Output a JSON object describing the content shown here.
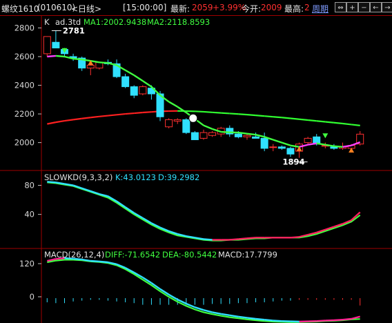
{
  "header": {
    "symbol": "螺纹1610",
    "code": "(010610)",
    "period": "<日线>",
    "time": "[15:00:00]",
    "latest_label": "最新:",
    "latest_value": "2059",
    "change_pct": "+3.99%",
    "open_label": "今开:",
    "open_value": "2009",
    "high_label": "最高:",
    "high_value": "2",
    "cycle_link": "周期",
    "buttons": [
      {
        "icon": "expand-icon",
        "glyph": "⇔"
      },
      {
        "icon": "zoom-in-icon",
        "glyph": "+"
      },
      {
        "icon": "zoom-out-icon",
        "glyph": "−"
      },
      {
        "icon": "arrow-left-icon",
        "glyph": "←"
      },
      {
        "icon": "arrow-right-icon",
        "glyph": "→"
      }
    ]
  },
  "colors": {
    "up": "#ff3030",
    "down": "#30e0ff",
    "ma1": "#40ff40",
    "ma2_down": "#30ff30",
    "ma2_up": "#ff2020",
    "k_line": "#30e0ff",
    "d_line": "#40ff40",
    "diff_line": "#30e0ff",
    "dea_line": "#40ff40",
    "grid": "#a00000"
  },
  "chart_data": [
    {
      "type": "candlestick",
      "panel": "price",
      "label": "K",
      "contract": "ad.3td",
      "indicator_text": [
        "MA1:2002.9438",
        "MA2:2118.8593"
      ],
      "ylim": [
        1820,
        2860
      ],
      "yticks": [
        2000,
        2200,
        2400,
        2600,
        2800
      ],
      "annotations": [
        {
          "text": "2781",
          "bar": 1,
          "value": 2781
        },
        {
          "text": "1894",
          "bar": 29,
          "value": 1894
        }
      ],
      "ohlc": [
        [
          2620,
          2740,
          2600,
          2740
        ],
        [
          2700,
          2781,
          2660,
          2660
        ],
        [
          2650,
          2660,
          2600,
          2620
        ],
        [
          2600,
          2620,
          2570,
          2590
        ],
        [
          2590,
          2600,
          2500,
          2520
        ],
        [
          2520,
          2550,
          2470,
          2540
        ],
        [
          2520,
          2560,
          2510,
          2560
        ],
        [
          2560,
          2580,
          2540,
          2550
        ],
        [
          2550,
          2580,
          2450,
          2460
        ],
        [
          2460,
          2480,
          2380,
          2390
        ],
        [
          2390,
          2400,
          2310,
          2330
        ],
        [
          2340,
          2400,
          2330,
          2390
        ],
        [
          2380,
          2400,
          2300,
          2340
        ],
        [
          2340,
          2360,
          2150,
          2180
        ],
        [
          2110,
          2170,
          2100,
          2160
        ],
        [
          2150,
          2170,
          2130,
          2160
        ],
        [
          2160,
          2170,
          2060,
          2070
        ],
        [
          2070,
          2080,
          2020,
          2020
        ],
        [
          2030,
          2090,
          2020,
          2070
        ],
        [
          2050,
          2080,
          2040,
          2070
        ],
        [
          2060,
          2110,
          2040,
          2100
        ],
        [
          2100,
          2120,
          2040,
          2060
        ],
        [
          2060,
          2080,
          2030,
          2040
        ],
        [
          2040,
          2060,
          2020,
          2050
        ],
        [
          2040,
          2070,
          2030,
          2030
        ],
        [
          2030,
          2070,
          1940,
          1960
        ],
        [
          1970,
          1990,
          1940,
          1970
        ],
        [
          1970,
          1980,
          1950,
          1960
        ],
        [
          1960,
          1970,
          1900,
          1920
        ],
        [
          1940,
          2000,
          1894,
          1990
        ],
        [
          2000,
          2040,
          1990,
          2030
        ],
        [
          2040,
          2060,
          1980,
          1990
        ],
        [
          1980,
          2000,
          1960,
          1980
        ],
        [
          1970,
          1990,
          1950,
          1960
        ],
        [
          1960,
          2000,
          1950,
          1970
        ],
        [
          1960,
          1990,
          1950,
          1980
        ],
        [
          1990,
          2080,
          1980,
          2059
        ]
      ],
      "ma1": [
        2600,
        2605,
        2600,
        2585,
        2580,
        2570,
        2560,
        2555,
        2540,
        2505,
        2470,
        2430,
        2390,
        2330,
        2285,
        2250,
        2210,
        2165,
        2120,
        2095,
        2075,
        2072,
        2070,
        2062,
        2055,
        2040,
        2020,
        2000,
        1980,
        1970,
        1985,
        1995,
        1985,
        1975,
        1970,
        1980,
        2003
      ],
      "ma2": [
        2130,
        2142,
        2152,
        2160,
        2168,
        2175,
        2182,
        2188,
        2194,
        2200,
        2205,
        2210,
        2214,
        2218,
        2220,
        2221,
        2220,
        2218,
        2215,
        2211,
        2207,
        2203,
        2199,
        2195,
        2190,
        2185,
        2180,
        2175,
        2169,
        2163,
        2157,
        2151,
        2145,
        2139,
        2133,
        2126,
        2119
      ]
    },
    {
      "type": "line",
      "panel": "slowkd",
      "label": "SLOWKD(9,3,3,2)",
      "indicator_text": [
        "K:43.0123",
        "D:39.2982"
      ],
      "ylim": [
        -5,
        90
      ],
      "yticks": [
        40,
        80
      ],
      "series": [
        {
          "name": "K",
          "values": [
            85,
            84,
            82,
            80,
            76,
            72,
            68,
            65,
            58,
            50,
            42,
            35,
            28,
            22,
            17,
            13,
            10,
            8,
            6,
            5,
            5,
            5,
            6,
            7,
            8,
            8,
            8,
            8,
            8,
            9,
            12,
            15,
            19,
            23,
            27,
            32,
            43
          ]
        },
        {
          "name": "D",
          "values": [
            84,
            83,
            81,
            79,
            75,
            71,
            67,
            63,
            56,
            48,
            40,
            33,
            26,
            20,
            15,
            11,
            9,
            7,
            5,
            4,
            4,
            5,
            5,
            6,
            7,
            7,
            8,
            8,
            8,
            8,
            10,
            13,
            17,
            21,
            25,
            30,
            39
          ]
        }
      ]
    },
    {
      "type": "line",
      "panel": "macd",
      "label": "MACD(26,12,4)",
      "indicator_text": [
        "DIFF:-71.6542",
        "DEA:-80.5442",
        "MACD:17.7799"
      ],
      "ylim": [
        -95,
        150
      ],
      "yticks": [
        0,
        120
      ],
      "series": [
        {
          "name": "DIFF",
          "values": [
            130,
            137,
            140,
            138,
            135,
            130,
            128,
            125,
            118,
            105,
            88,
            70,
            50,
            28,
            8,
            -10,
            -25,
            -38,
            -48,
            -56,
            -62,
            -67,
            -72,
            -76,
            -80,
            -83,
            -86,
            -88,
            -89,
            -90,
            -89,
            -88,
            -86,
            -85,
            -83,
            -80,
            -71.65
          ]
        },
        {
          "name": "DEA",
          "values": [
            125,
            131,
            134,
            134,
            132,
            128,
            126,
            122,
            114,
            100,
            82,
            62,
            42,
            20,
            0,
            -18,
            -33,
            -46,
            -56,
            -63,
            -69,
            -74,
            -78,
            -82,
            -85,
            -88,
            -90,
            -91,
            -92,
            -92,
            -91,
            -90,
            -88,
            -87,
            -85,
            -82,
            -80.54
          ]
        }
      ],
      "histogram": [
        10,
        12,
        12,
        8,
        6,
        4,
        4,
        6,
        8,
        10,
        12,
        16,
        16,
        16,
        16,
        16,
        16,
        16,
        16,
        14,
        14,
        14,
        12,
        12,
        10,
        10,
        8,
        6,
        6,
        4,
        4,
        4,
        4,
        4,
        4,
        4,
        17.78
      ]
    }
  ]
}
